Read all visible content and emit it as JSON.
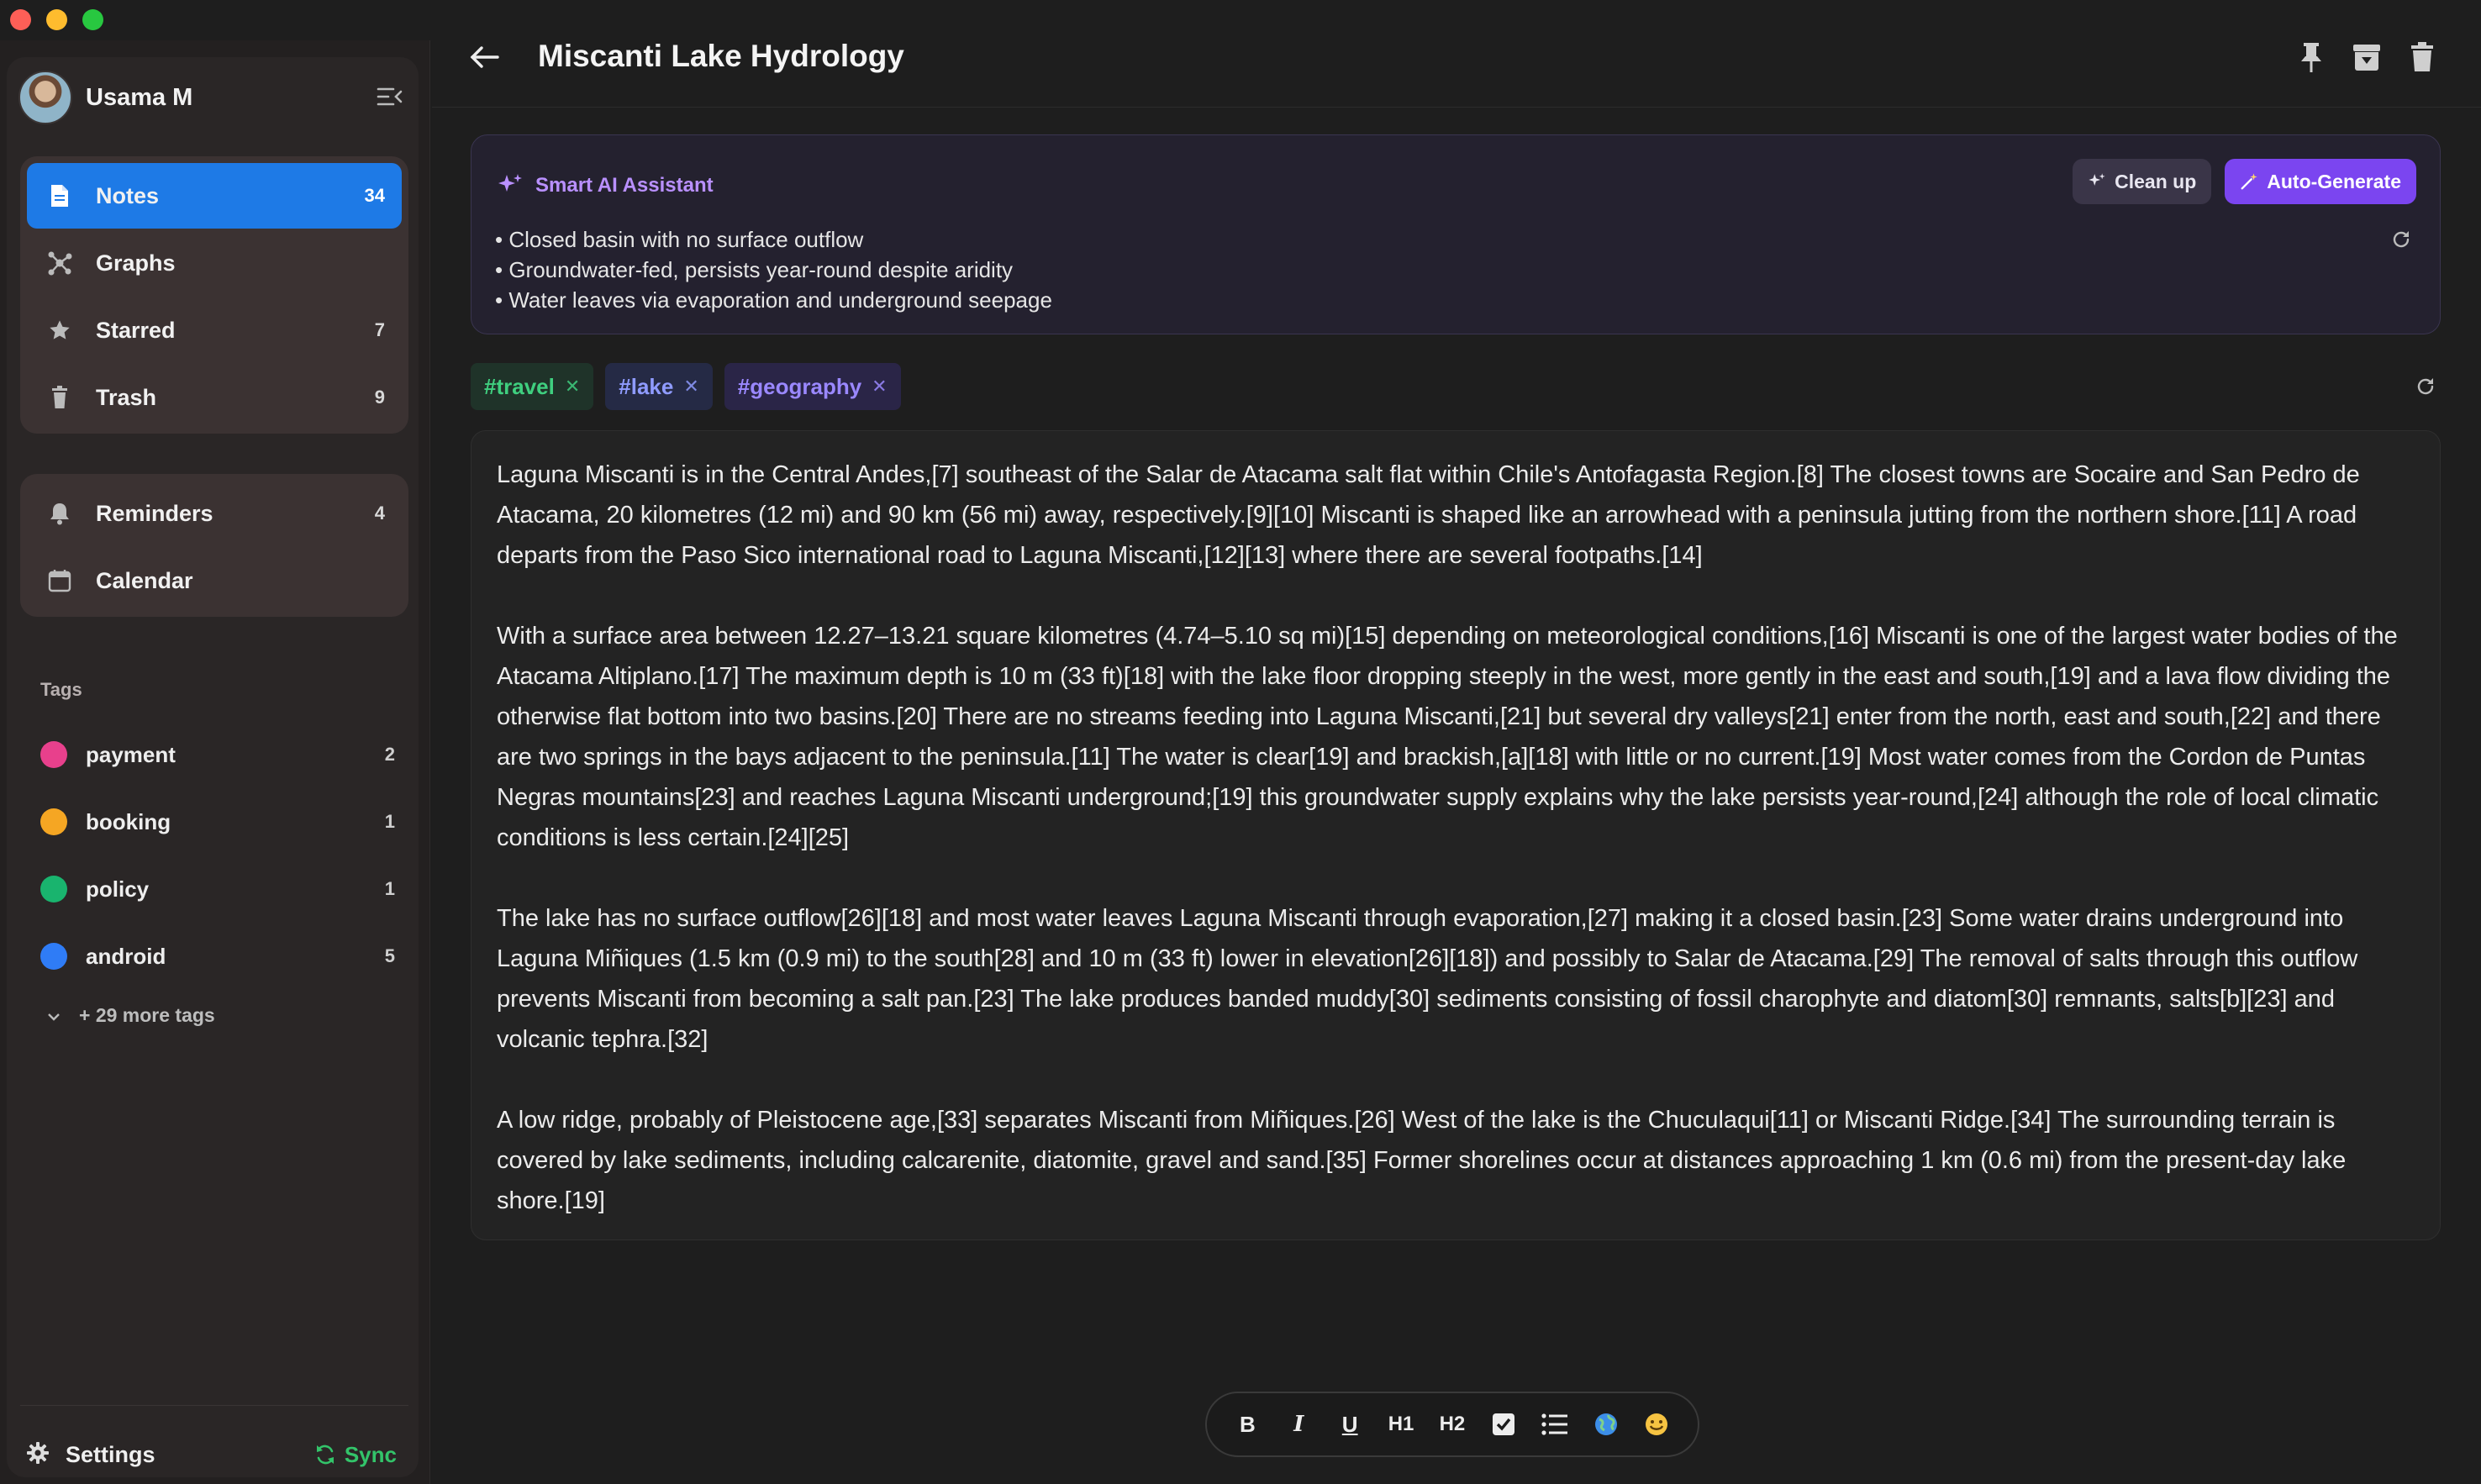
{
  "user": {
    "name": "Usama M"
  },
  "nav": {
    "primary": [
      {
        "label": "Notes",
        "count": "34"
      },
      {
        "label": "Graphs",
        "count": ""
      },
      {
        "label": "Starred",
        "count": "7"
      },
      {
        "label": "Trash",
        "count": "9"
      }
    ],
    "secondary": [
      {
        "label": "Reminders",
        "count": "4"
      },
      {
        "label": "Calendar",
        "count": ""
      }
    ]
  },
  "tags": {
    "title": "Tags",
    "items": [
      {
        "label": "payment",
        "count": "2",
        "color": "#e8408c"
      },
      {
        "label": "booking",
        "count": "1",
        "color": "#f5a623"
      },
      {
        "label": "policy",
        "count": "1",
        "color": "#19b46e"
      },
      {
        "label": "android",
        "count": "5",
        "color": "#2f7cf6"
      }
    ],
    "more": "+ 29 more tags"
  },
  "footer": {
    "settings": "Settings",
    "sync": "Sync"
  },
  "note": {
    "title": "Miscanti Lake Hydrology",
    "tags": [
      {
        "label": "#travel"
      },
      {
        "label": "#lake"
      },
      {
        "label": "#geography"
      }
    ],
    "paragraphs": [
      "Laguna Miscanti is in the Central Andes,[7] southeast of the Salar de Atacama salt flat within Chile's Antofagasta Region.[8] The closest towns are Socaire and San Pedro de Atacama, 20 kilometres (12 mi) and 90 km (56 mi) away, respectively.[9][10] Miscanti is shaped like an arrowhead with a peninsula jutting from the northern shore.[11] A road departs from the Paso Sico international road to Laguna Miscanti,[12][13] where there are several footpaths.[14]",
      "With a surface area between 12.27–13.21 square kilometres (4.74–5.10 sq mi)[15] depending on meteorological conditions,[16] Miscanti is one of the largest water bodies of the Atacama Altiplano.[17] The maximum depth is 10 m (33 ft)[18] with the lake floor dropping steeply in the west, more gently in the east and south,[19] and a lava flow dividing the otherwise flat bottom into two basins.[20] There are no streams feeding into Laguna Miscanti,[21] but several dry valleys[21] enter from the north, east and south,[22] and there are two springs in the bays adjacent to the peninsula.[11] The water is clear[19] and brackish,[a][18] with little or no current.[19] Most water comes from the Cordon de Puntas Negras mountains[23] and reaches Laguna Miscanti underground;[19] this groundwater supply explains why the lake persists year-round,[24] although the role of local climatic conditions is less certain.[24][25]",
      "The lake has no surface outflow[26][18] and most water leaves Laguna Miscanti through evaporation,[27] making it a closed basin.[23] Some water drains underground into Laguna Miñiques (1.5 km (0.9 mi) to the south[28] and 10 m (33 ft) lower in elevation[26][18]) and possibly to Salar de Atacama.[29] The removal of salts through this outflow prevents Miscanti from becoming a salt pan.[23] The lake produces banded muddy[30] sediments consisting of fossil charophyte and diatom[30] remnants, salts[b][23] and volcanic tephra.[32]",
      "A low ridge, probably of Pleistocene age,[33] separates Miscanti from Miñiques.[26] West of the lake is the Chuculaqui[11] or Miscanti Ridge.[34] The surrounding terrain is covered by lake sediments, including calcarenite, diatomite, gravel and sand.[35] Former shorelines occur at distances approaching 1 km (0.6 mi) from the present-day lake shore.[19]"
    ]
  },
  "ai": {
    "title": "Smart AI Assistant",
    "clean_label": "Clean up",
    "auto_label": "Auto-Generate",
    "bullets": [
      "Closed basin with no surface outflow",
      "Groundwater-fed, persists year-round despite aridity",
      "Water leaves via evaporation and underground seepage"
    ]
  },
  "toolbar": {
    "bold": "B",
    "italic": "I",
    "underline": "U",
    "h1": "H1",
    "h2": "H2"
  },
  "colors": {
    "accent": "#1e7ae6",
    "ai_purple": "#7b45f0",
    "sync_green": "#33c46a"
  }
}
